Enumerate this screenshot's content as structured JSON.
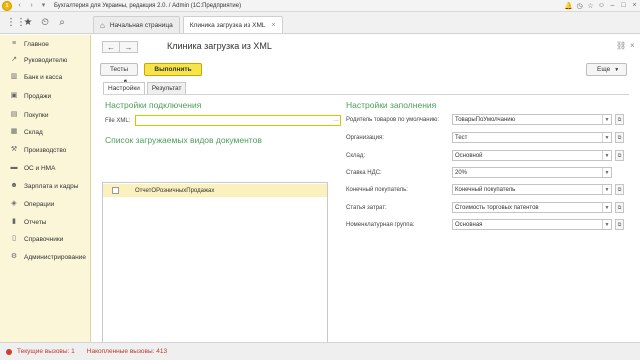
{
  "window": {
    "title": "Бухгалтерия для Украины, редакция 2.0. / Admin  (1С:Предприятие)"
  },
  "tabs": [
    {
      "label": "Начальная страница"
    },
    {
      "label": "Клиника загрузка из XML"
    }
  ],
  "sidebar": {
    "items": [
      {
        "label": "Главное",
        "icon": "menu-lines-icon"
      },
      {
        "label": "Руководителю",
        "icon": "trend-chart-icon"
      },
      {
        "label": "Банк и касса",
        "icon": "bank-icon"
      },
      {
        "label": "Продажи",
        "icon": "shopping-bag-icon"
      },
      {
        "label": "Покупки",
        "icon": "basket-icon"
      },
      {
        "label": "Склад",
        "icon": "warehouse-icon"
      },
      {
        "label": "Производство",
        "icon": "factory-icon"
      },
      {
        "label": "ОС и НМА",
        "icon": "assets-icon"
      },
      {
        "label": "Зарплата и кадры",
        "icon": "people-icon"
      },
      {
        "label": "Операции",
        "icon": "operations-icon"
      },
      {
        "label": "Отчеты",
        "icon": "reports-icon"
      },
      {
        "label": "Справочники",
        "icon": "books-icon"
      },
      {
        "label": "Администрирование",
        "icon": "gear-icon"
      }
    ]
  },
  "form": {
    "title": "Клиника загрузка из XML",
    "buttons": {
      "tests": "Тесты",
      "run": "Выполнить",
      "more": "Еще"
    },
    "subtabs": [
      {
        "label": "Настройки"
      },
      {
        "label": "Результат"
      }
    ],
    "connection": {
      "heading": "Настройки подключения",
      "file_label": "File XML:",
      "file_value": ""
    },
    "doc_list": {
      "heading": "Список загружаемых видов документов",
      "items": [
        {
          "label": "ОтчетОРозничныхПродажах",
          "checked": false
        }
      ]
    },
    "fill": {
      "heading": "Настройки заполнения",
      "fields": [
        {
          "label": "Родитель товаров по умолчанию:",
          "value": "ТоварыПоУмолчанию"
        },
        {
          "label": "Организация:",
          "value": "Тест"
        },
        {
          "label": "Склад:",
          "value": "Основной"
        },
        {
          "label": "Ставка НДС:",
          "value": "20%"
        },
        {
          "label": "Конечный покупатель:",
          "value": "Конечный покупатель"
        },
        {
          "label": "Статья затрат:",
          "value": "Стоимость торговых патентов"
        },
        {
          "label": "Номенклатурная группа:",
          "value": "Основная"
        }
      ]
    }
  },
  "status": {
    "current_calls": "Текущие вызовы: 1",
    "accumulated_calls": "Накопленные вызовы: 413"
  },
  "colors": {
    "accent_yellow": "#f7e34a",
    "sidebar_bg": "#fbf6d8",
    "heading_green": "#4d9d5a",
    "status_red": "#c0392b"
  }
}
